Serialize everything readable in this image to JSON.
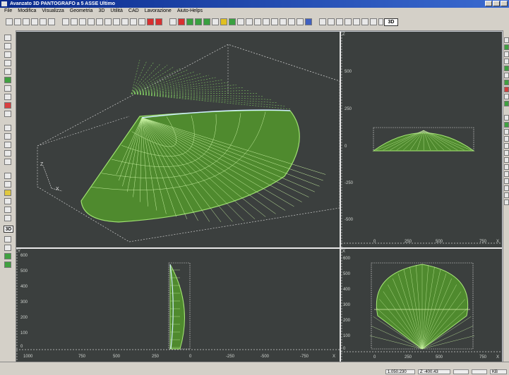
{
  "window": {
    "title": "Avanzato 3D PANTOGRAFO a 5 ASSE Ultimo"
  },
  "menu": [
    "File",
    "Modifica",
    "Visualizza",
    "Geometria",
    "3D",
    "Utilità",
    "CAD",
    "Lavorazione",
    "Aiuto-Helps"
  ],
  "toolbar": {
    "mode_label": "3D"
  },
  "left_toolbar": {
    "mode_label": "3D"
  },
  "views": {
    "main": {
      "axis_z": "Z",
      "axis_x": "X"
    },
    "top_right": {
      "corner": "Z",
      "axis_end": "X",
      "y_ticks": [
        "500",
        "250",
        "0",
        "-250",
        "-500"
      ],
      "x_ticks": [
        "0",
        "250",
        "500",
        "750"
      ]
    },
    "bottom_left": {
      "corner": "Y",
      "axis_end": "X",
      "y_ticks": [
        "600",
        "500",
        "400",
        "300",
        "200",
        "100",
        "0"
      ],
      "x_ticks": [
        "1000",
        "750",
        "500",
        "250",
        "0",
        "-250",
        "-500",
        "-750"
      ]
    },
    "bottom_right": {
      "corner": "X",
      "axis_end": "X",
      "y_ticks": [
        "600",
        "500",
        "400",
        "300",
        "200",
        "100",
        "0"
      ],
      "x_ticks": [
        "0",
        "250",
        "500",
        "750"
      ]
    }
  },
  "status": {
    "field1": "1.050.230",
    "field2": "Z -400.43",
    "field3": "",
    "field4": "",
    "field5": "KB"
  },
  "colors": {
    "viewport_bg": "#3b3f3e",
    "mesh": "#8fd86a",
    "highlight": "#bfe8ff"
  }
}
